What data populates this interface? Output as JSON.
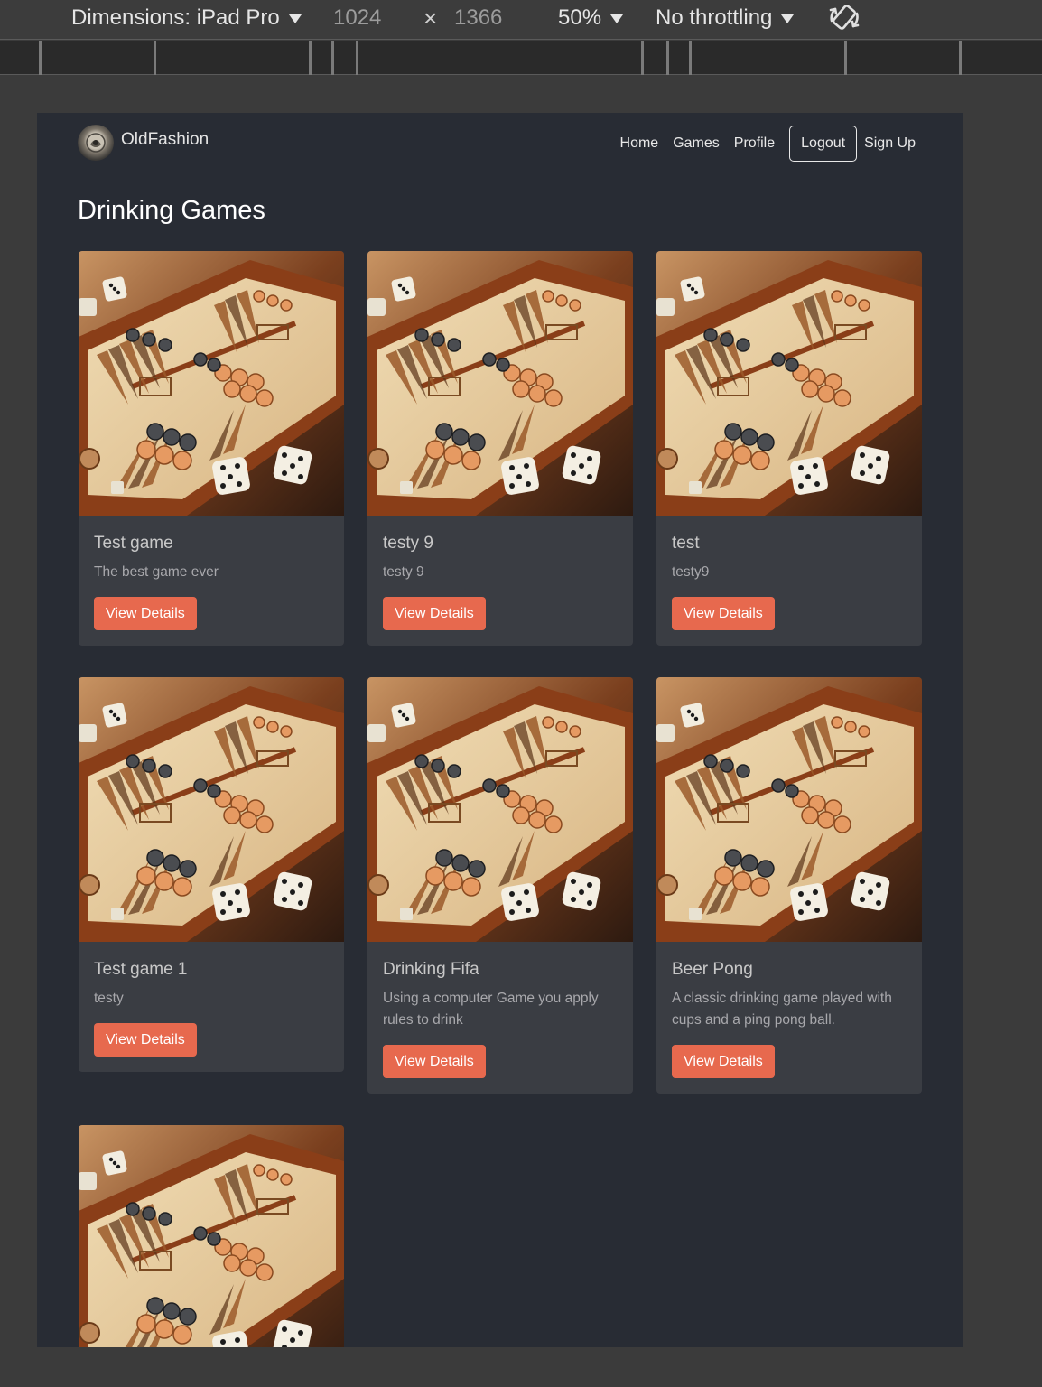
{
  "devtools": {
    "dimensions_label": "Dimensions: iPad Pro",
    "width": "1024",
    "times": "×",
    "height": "1366",
    "zoom": "50%",
    "throttling": "No throttling"
  },
  "nav": {
    "brand": "OldFashion",
    "links": [
      "Home",
      "Games",
      "Profile",
      "Logout",
      "Sign Up"
    ]
  },
  "page": {
    "title": "Drinking Games"
  },
  "games": [
    {
      "title": "Test game",
      "description": "The best game ever",
      "button": "View Details"
    },
    {
      "title": "testy 9",
      "description": "testy 9",
      "button": "View Details"
    },
    {
      "title": "test",
      "description": "testy9",
      "button": "View Details"
    },
    {
      "title": "Test game 1",
      "description": "testy",
      "button": "View Details"
    },
    {
      "title": "Drinking Fifa",
      "description": "Using a computer Game you apply rules to drink",
      "button": "View Details"
    },
    {
      "title": "Beer Pong",
      "description": "A classic drinking game played with cups and a ping pong ball.",
      "button": "View Details"
    },
    {
      "title": "",
      "description": "",
      "button": ""
    }
  ],
  "colors": {
    "page_bg": "#282c34",
    "card_bg": "#3a3d43",
    "accent_button": "#e7694e"
  },
  "icons": {
    "rotate": "rotate-device-icon",
    "logo": "brand-logo-icon",
    "card_image": "backgammon-board-image"
  }
}
